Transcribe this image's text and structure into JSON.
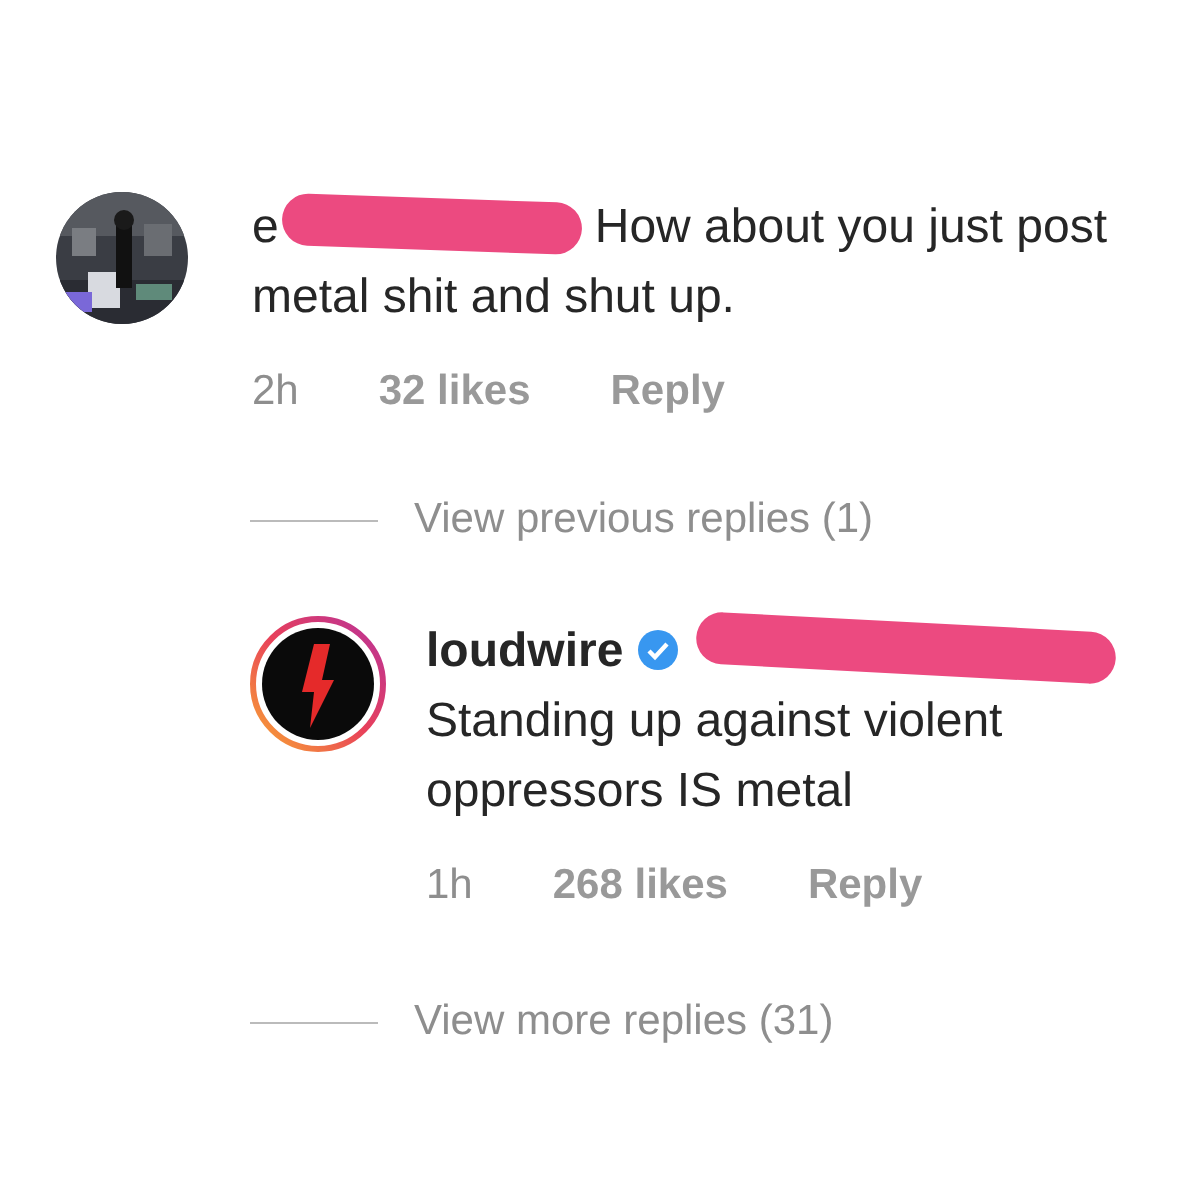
{
  "comment": {
    "username_visible": "e",
    "text": "How about you just post metal shit and shut up.",
    "time": "2h",
    "likes": "32 likes",
    "reply": "Reply"
  },
  "view_previous": "View previous replies (1)",
  "reply": {
    "username": "loudwire",
    "verified": true,
    "text": "Standing up against violent oppressors IS metal",
    "time": "1h",
    "likes": "268 likes",
    "reply": "Reply"
  },
  "view_more": "View more replies (31)"
}
